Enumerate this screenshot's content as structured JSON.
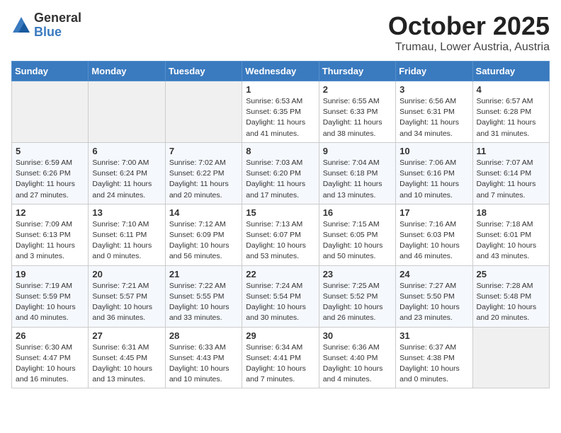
{
  "header": {
    "logo_general": "General",
    "logo_blue": "Blue",
    "month": "October 2025",
    "location": "Trumau, Lower Austria, Austria"
  },
  "weekdays": [
    "Sunday",
    "Monday",
    "Tuesday",
    "Wednesday",
    "Thursday",
    "Friday",
    "Saturday"
  ],
  "weeks": [
    [
      {
        "day": "",
        "info": ""
      },
      {
        "day": "",
        "info": ""
      },
      {
        "day": "",
        "info": ""
      },
      {
        "day": "1",
        "info": "Sunrise: 6:53 AM\nSunset: 6:35 PM\nDaylight: 11 hours\nand 41 minutes."
      },
      {
        "day": "2",
        "info": "Sunrise: 6:55 AM\nSunset: 6:33 PM\nDaylight: 11 hours\nand 38 minutes."
      },
      {
        "day": "3",
        "info": "Sunrise: 6:56 AM\nSunset: 6:31 PM\nDaylight: 11 hours\nand 34 minutes."
      },
      {
        "day": "4",
        "info": "Sunrise: 6:57 AM\nSunset: 6:28 PM\nDaylight: 11 hours\nand 31 minutes."
      }
    ],
    [
      {
        "day": "5",
        "info": "Sunrise: 6:59 AM\nSunset: 6:26 PM\nDaylight: 11 hours\nand 27 minutes."
      },
      {
        "day": "6",
        "info": "Sunrise: 7:00 AM\nSunset: 6:24 PM\nDaylight: 11 hours\nand 24 minutes."
      },
      {
        "day": "7",
        "info": "Sunrise: 7:02 AM\nSunset: 6:22 PM\nDaylight: 11 hours\nand 20 minutes."
      },
      {
        "day": "8",
        "info": "Sunrise: 7:03 AM\nSunset: 6:20 PM\nDaylight: 11 hours\nand 17 minutes."
      },
      {
        "day": "9",
        "info": "Sunrise: 7:04 AM\nSunset: 6:18 PM\nDaylight: 11 hours\nand 13 minutes."
      },
      {
        "day": "10",
        "info": "Sunrise: 7:06 AM\nSunset: 6:16 PM\nDaylight: 11 hours\nand 10 minutes."
      },
      {
        "day": "11",
        "info": "Sunrise: 7:07 AM\nSunset: 6:14 PM\nDaylight: 11 hours\nand 7 minutes."
      }
    ],
    [
      {
        "day": "12",
        "info": "Sunrise: 7:09 AM\nSunset: 6:13 PM\nDaylight: 11 hours\nand 3 minutes."
      },
      {
        "day": "13",
        "info": "Sunrise: 7:10 AM\nSunset: 6:11 PM\nDaylight: 11 hours\nand 0 minutes."
      },
      {
        "day": "14",
        "info": "Sunrise: 7:12 AM\nSunset: 6:09 PM\nDaylight: 10 hours\nand 56 minutes."
      },
      {
        "day": "15",
        "info": "Sunrise: 7:13 AM\nSunset: 6:07 PM\nDaylight: 10 hours\nand 53 minutes."
      },
      {
        "day": "16",
        "info": "Sunrise: 7:15 AM\nSunset: 6:05 PM\nDaylight: 10 hours\nand 50 minutes."
      },
      {
        "day": "17",
        "info": "Sunrise: 7:16 AM\nSunset: 6:03 PM\nDaylight: 10 hours\nand 46 minutes."
      },
      {
        "day": "18",
        "info": "Sunrise: 7:18 AM\nSunset: 6:01 PM\nDaylight: 10 hours\nand 43 minutes."
      }
    ],
    [
      {
        "day": "19",
        "info": "Sunrise: 7:19 AM\nSunset: 5:59 PM\nDaylight: 10 hours\nand 40 minutes."
      },
      {
        "day": "20",
        "info": "Sunrise: 7:21 AM\nSunset: 5:57 PM\nDaylight: 10 hours\nand 36 minutes."
      },
      {
        "day": "21",
        "info": "Sunrise: 7:22 AM\nSunset: 5:55 PM\nDaylight: 10 hours\nand 33 minutes."
      },
      {
        "day": "22",
        "info": "Sunrise: 7:24 AM\nSunset: 5:54 PM\nDaylight: 10 hours\nand 30 minutes."
      },
      {
        "day": "23",
        "info": "Sunrise: 7:25 AM\nSunset: 5:52 PM\nDaylight: 10 hours\nand 26 minutes."
      },
      {
        "day": "24",
        "info": "Sunrise: 7:27 AM\nSunset: 5:50 PM\nDaylight: 10 hours\nand 23 minutes."
      },
      {
        "day": "25",
        "info": "Sunrise: 7:28 AM\nSunset: 5:48 PM\nDaylight: 10 hours\nand 20 minutes."
      }
    ],
    [
      {
        "day": "26",
        "info": "Sunrise: 6:30 AM\nSunset: 4:47 PM\nDaylight: 10 hours\nand 16 minutes."
      },
      {
        "day": "27",
        "info": "Sunrise: 6:31 AM\nSunset: 4:45 PM\nDaylight: 10 hours\nand 13 minutes."
      },
      {
        "day": "28",
        "info": "Sunrise: 6:33 AM\nSunset: 4:43 PM\nDaylight: 10 hours\nand 10 minutes."
      },
      {
        "day": "29",
        "info": "Sunrise: 6:34 AM\nSunset: 4:41 PM\nDaylight: 10 hours\nand 7 minutes."
      },
      {
        "day": "30",
        "info": "Sunrise: 6:36 AM\nSunset: 4:40 PM\nDaylight: 10 hours\nand 4 minutes."
      },
      {
        "day": "31",
        "info": "Sunrise: 6:37 AM\nSunset: 4:38 PM\nDaylight: 10 hours\nand 0 minutes."
      },
      {
        "day": "",
        "info": ""
      }
    ]
  ]
}
